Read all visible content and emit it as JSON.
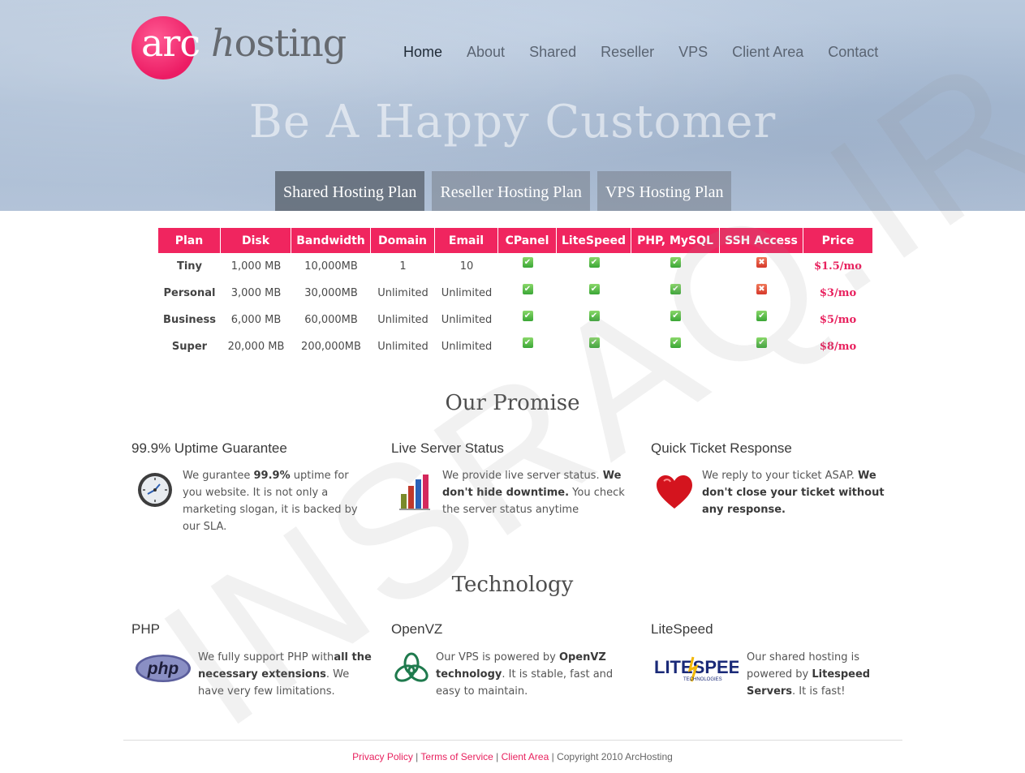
{
  "brand": {
    "logo_prefix": "arc",
    "logo_h": "h",
    "logo_suffix": "osting",
    "accent": "#f0255f"
  },
  "nav": {
    "items": [
      "Home",
      "About",
      "Shared",
      "Reseller",
      "VPS",
      "Client Area",
      "Contact"
    ],
    "active": "Home"
  },
  "hero": {
    "title": "Be A Happy Customer",
    "tabs": [
      "Shared Hosting Plan",
      "Reseller Hosting Plan",
      "VPS Hosting Plan"
    ],
    "active_tab": "Shared Hosting Plan"
  },
  "pricing": {
    "headers": [
      "Plan",
      "Disk",
      "Bandwidth",
      "Domain",
      "Email",
      "CPanel",
      "LiteSpeed",
      "PHP, MySQL",
      "SSH Access",
      "Price"
    ],
    "rows": [
      {
        "plan": "Tiny",
        "disk": "1,000 MB",
        "bandwidth": "10,000MB",
        "domain": "1",
        "email": "10",
        "cpanel": true,
        "litespeed": true,
        "php": true,
        "ssh": false,
        "price": "$1.5/mo"
      },
      {
        "plan": "Personal",
        "disk": "3,000 MB",
        "bandwidth": "30,000MB",
        "domain": "Unlimited",
        "email": "Unlimited",
        "cpanel": true,
        "litespeed": true,
        "php": true,
        "ssh": false,
        "price": "$3/mo"
      },
      {
        "plan": "Business",
        "disk": "6,000 MB",
        "bandwidth": "60,000MB",
        "domain": "Unlimited",
        "email": "Unlimited",
        "cpanel": true,
        "litespeed": true,
        "php": true,
        "ssh": true,
        "price": "$5/mo"
      },
      {
        "plan": "Super",
        "disk": "20,000 MB",
        "bandwidth": "200,000MB",
        "domain": "Unlimited",
        "email": "Unlimited",
        "cpanel": true,
        "litespeed": true,
        "php": true,
        "ssh": true,
        "price": "$8/mo"
      }
    ],
    "check_color": "#3aa636",
    "cross_color": "#d6382a"
  },
  "promise": {
    "title": "Our Promise",
    "items": [
      {
        "heading": "99.9% Uptime Guarantee",
        "icon": "clock-icon",
        "t1": "We gurantee ",
        "b1": "99.9%",
        "t2": " uptime for you website. It is not only a marketing slogan, it is backed by our SLA."
      },
      {
        "heading": "Live Server Status",
        "icon": "bar-chart-icon",
        "t1": "We provide live server status. ",
        "b1": "We don't hide downtime.",
        "t2": " You check the server status anytime"
      },
      {
        "heading": "Quick Ticket Response",
        "icon": "heart-icon",
        "t1": "We reply to your ticket ASAP. ",
        "b1": "We don't close your ticket without any response.",
        "t2": ""
      }
    ]
  },
  "technology": {
    "title": "Technology",
    "items": [
      {
        "heading": "PHP",
        "icon": "php-logo-icon",
        "logo_text": "php",
        "t1": "We fully support PHP with",
        "b1": "all the necessary extensions",
        "t2": ". We have very few limitations."
      },
      {
        "heading": "OpenVZ",
        "icon": "openvz-logo-icon",
        "logo_text": "",
        "t1": "Our VPS is powered by ",
        "b1": "OpenVZ technology",
        "t2": ". It is stable, fast and easy to maintain."
      },
      {
        "heading": "LiteSpeed",
        "icon": "litespeed-logo-icon",
        "logo_text": "LITESPEED",
        "logo_sub": "TECHNOLOGIES",
        "t1": "Our shared hosting is powered by ",
        "b1": "Litespeed Servers",
        "t2": ". It is fast!"
      }
    ]
  },
  "footer": {
    "links": [
      "Privacy Policy",
      "Terms of Service",
      "Client Area"
    ],
    "separator": " | ",
    "copyright": "Copyright 2010 ArcHosting"
  },
  "watermark": "INSRAQ.IR"
}
